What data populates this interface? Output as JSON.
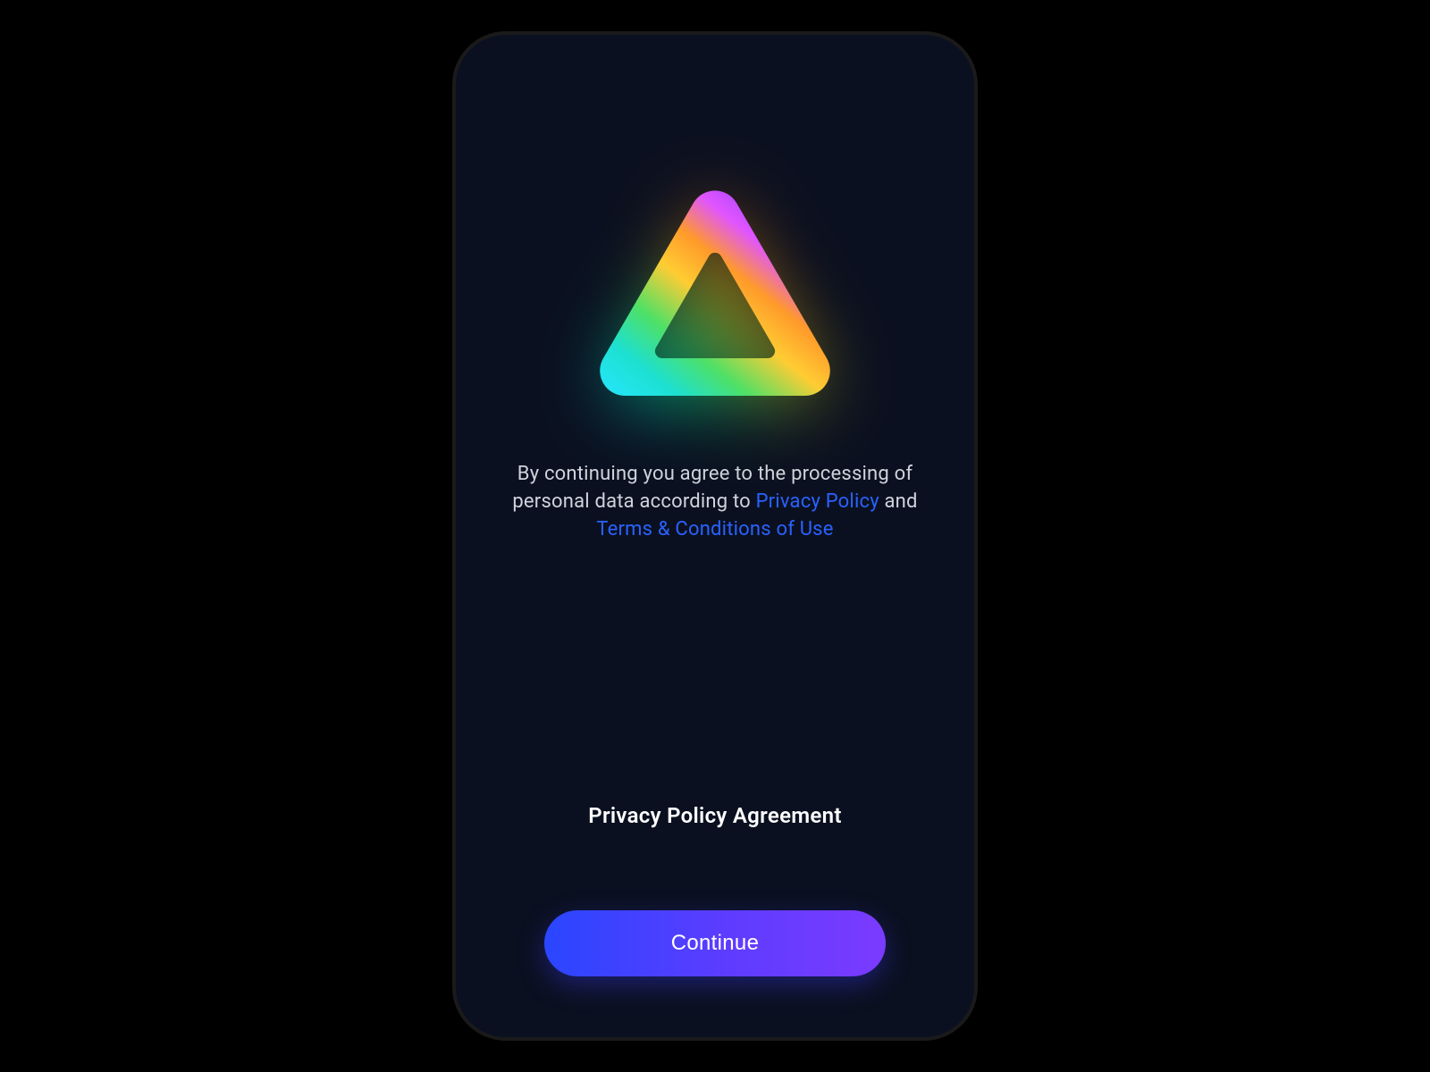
{
  "logo": {
    "icon_name": "prism-triangle-icon"
  },
  "consent": {
    "pre_text": "By continuing you agree to the processing of personal data according to ",
    "privacy_link": "Privacy Policy",
    "middle_text": " and ",
    "terms_link": "Terms & Conditions of Use"
  },
  "title": "Privacy Policy Agreement",
  "cta_label": "Continue"
}
